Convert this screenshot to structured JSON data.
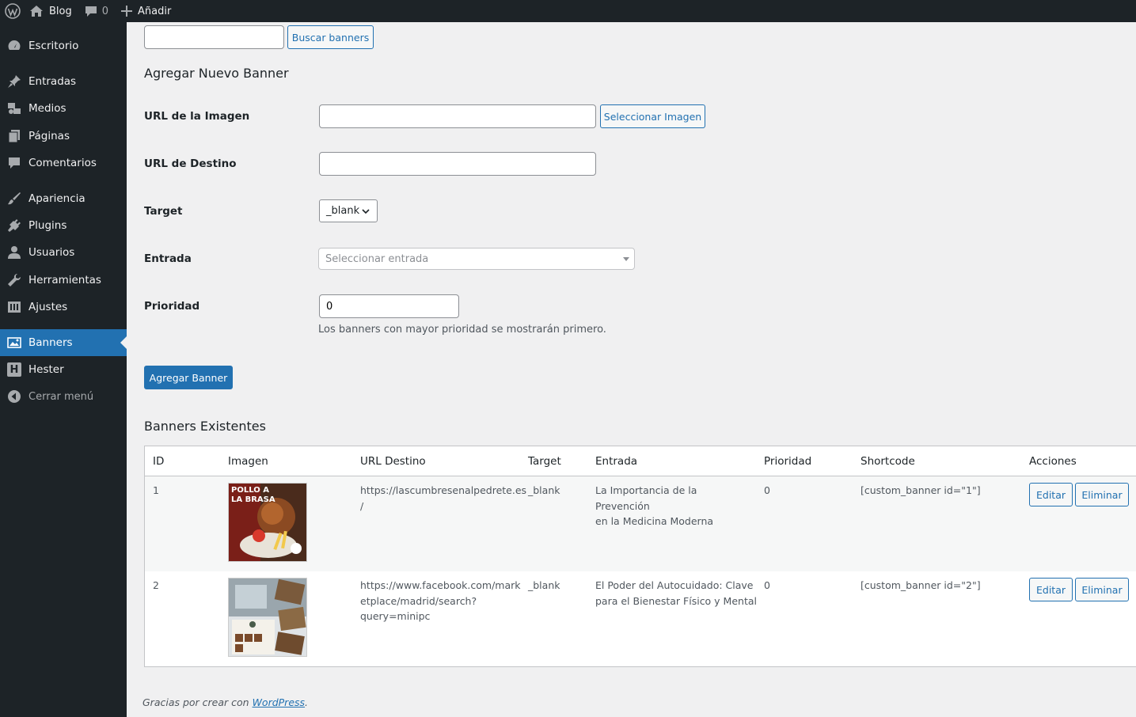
{
  "adminbar": {
    "site_name": "Blog",
    "comments_count": "0",
    "new_label": "Añadir"
  },
  "sidebar": {
    "items": [
      {
        "label": "Escritorio",
        "icon": "dashboard-icon"
      },
      {
        "label": "Entradas",
        "icon": "pin-icon"
      },
      {
        "label": "Medios",
        "icon": "media-icon"
      },
      {
        "label": "Páginas",
        "icon": "pages-icon"
      },
      {
        "label": "Comentarios",
        "icon": "comment-icon"
      },
      {
        "label": "Apariencia",
        "icon": "brush-icon"
      },
      {
        "label": "Plugins",
        "icon": "plugin-icon"
      },
      {
        "label": "Usuarios",
        "icon": "user-icon"
      },
      {
        "label": "Herramientas",
        "icon": "wrench-icon"
      },
      {
        "label": "Ajustes",
        "icon": "settings-icon"
      },
      {
        "label": "Banners",
        "icon": "banners-icon"
      },
      {
        "label": "Hester",
        "icon": "hester-icon"
      },
      {
        "label": "Cerrar menú",
        "icon": "collapse-icon"
      }
    ],
    "active_color": "#2271b1"
  },
  "search": {
    "value": "",
    "button_label": "Buscar banners"
  },
  "form": {
    "title": "Agregar Nuevo Banner",
    "image_url_label": "URL de la Imagen",
    "image_url_value": "",
    "select_image_label": "Seleccionar Imagen",
    "dest_url_label": "URL de Destino",
    "dest_url_value": "",
    "target_label": "Target",
    "target_value": "_blank",
    "entry_label": "Entrada",
    "entry_placeholder": "Seleccionar entrada",
    "priority_label": "Prioridad",
    "priority_value": "0",
    "priority_desc": "Los banners con mayor prioridad se mostrarán primero.",
    "submit_label": "Agregar Banner"
  },
  "table": {
    "title": "Banners Existentes",
    "headers": [
      "ID",
      "Imagen",
      "URL Destino",
      "Target",
      "Entrada",
      "Prioridad",
      "Shortcode",
      "Acciones"
    ],
    "rows": [
      {
        "id": "1",
        "url_lines": [
          "https://lascumbresenalpedrete.es",
          "/"
        ],
        "target": "_blank",
        "entry_lines": [
          "La Importancia de la Prevención",
          "en la Medicina Moderna"
        ],
        "priority": "0",
        "shortcode": "[custom_banner id=\"1\"]",
        "thumb_text": [
          "POLLO A",
          "LA BRASA"
        ]
      },
      {
        "id": "2",
        "url_lines": [
          "https://www.facebook.com/mark",
          "etplace/madrid/search?",
          "query=minipc"
        ],
        "target": "_blank",
        "entry_lines": [
          "El Poder del Autocuidado: Clave",
          "para el Bienestar Físico y Mental"
        ],
        "priority": "0",
        "shortcode": "[custom_banner id=\"2\"]",
        "thumb_text": []
      }
    ],
    "edit_label": "Editar",
    "delete_label": "Eliminar"
  },
  "footer": {
    "text": "Gracias por crear con ",
    "link": "WordPress",
    "suffix": "."
  }
}
